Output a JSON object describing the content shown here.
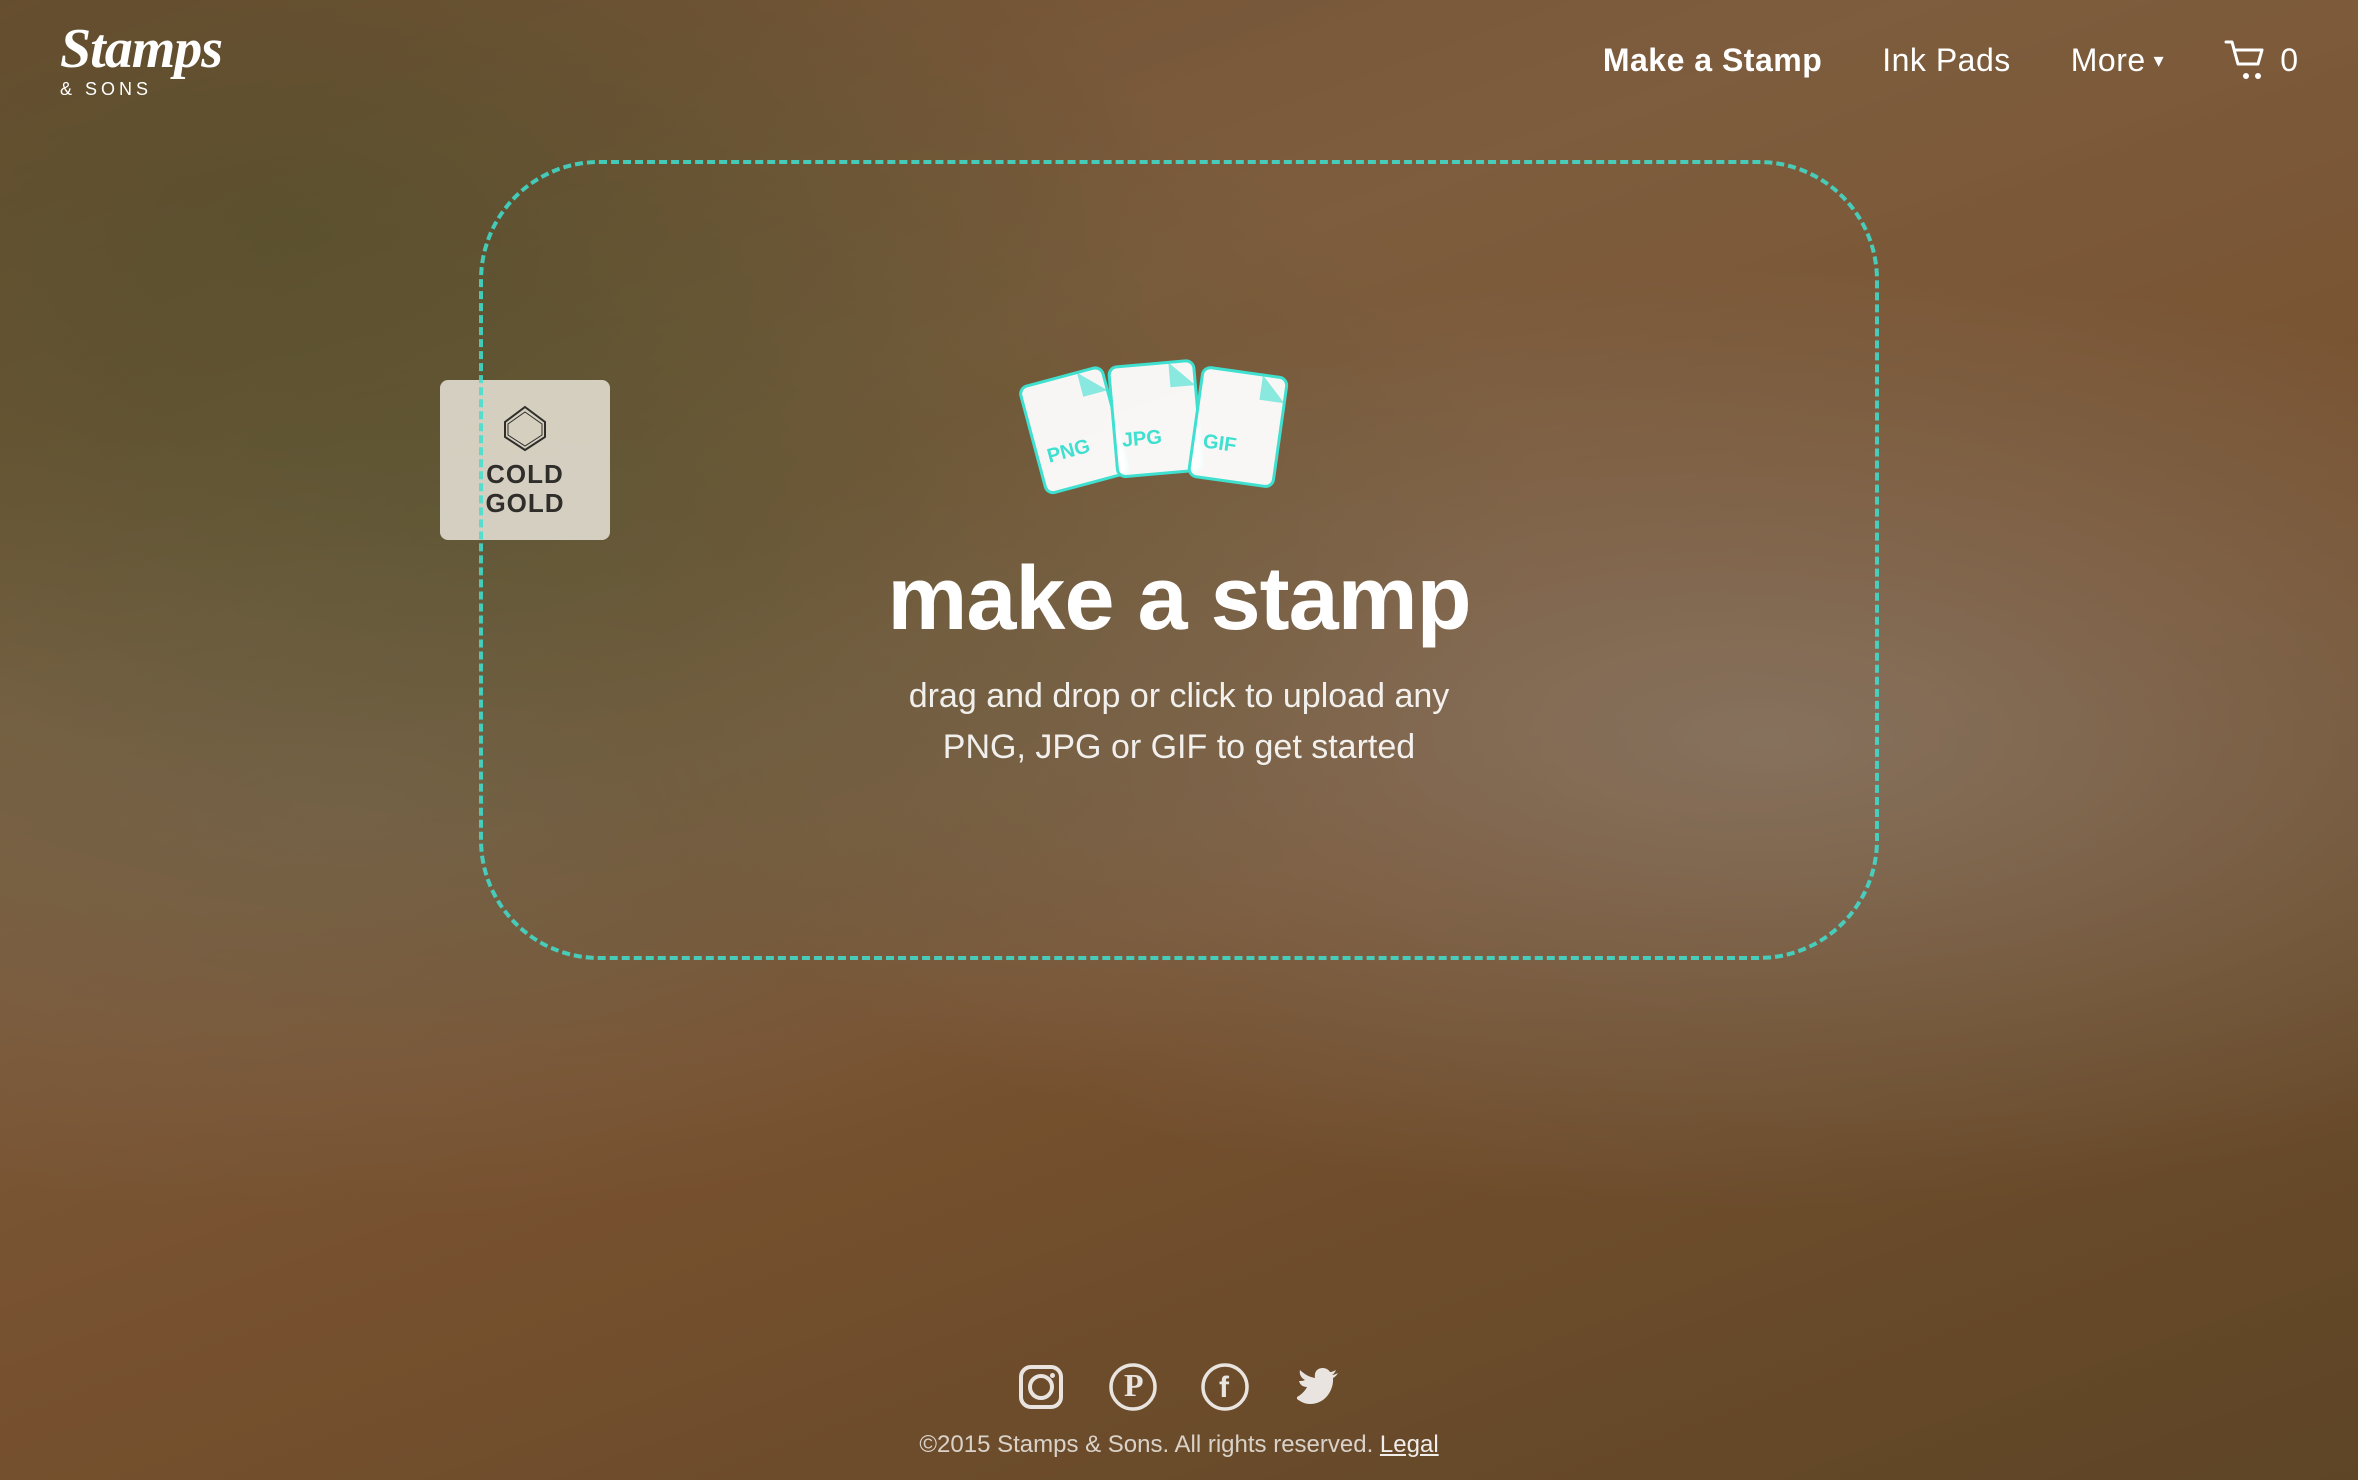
{
  "site": {
    "logo": {
      "name": "Stamps",
      "sub": "& SONS"
    }
  },
  "nav": {
    "links": [
      {
        "label": "Make a Stamp",
        "active": true,
        "id": "make-a-stamp"
      },
      {
        "label": "Ink Pads",
        "active": false,
        "id": "ink-pads"
      },
      {
        "label": "More",
        "active": false,
        "id": "more"
      }
    ],
    "cart_count": "0"
  },
  "hero": {
    "title": "make a stamp",
    "subtitle_line1": "drag and drop or click to upload any",
    "subtitle_line2": "PNG, JPG or GIF to get started",
    "file_types": [
      "PNG",
      "JPG",
      "GIF"
    ]
  },
  "footer": {
    "copyright": "©2015 Stamps & Sons. All rights reserved.",
    "legal_link": "Legal",
    "social": [
      {
        "name": "instagram",
        "id": "instagram-icon"
      },
      {
        "name": "pinterest",
        "id": "pinterest-icon"
      },
      {
        "name": "facebook",
        "id": "facebook-icon"
      },
      {
        "name": "twitter",
        "id": "twitter-icon"
      }
    ]
  },
  "colors": {
    "teal": "#40E0D0",
    "accent": "#3DD6C8"
  }
}
